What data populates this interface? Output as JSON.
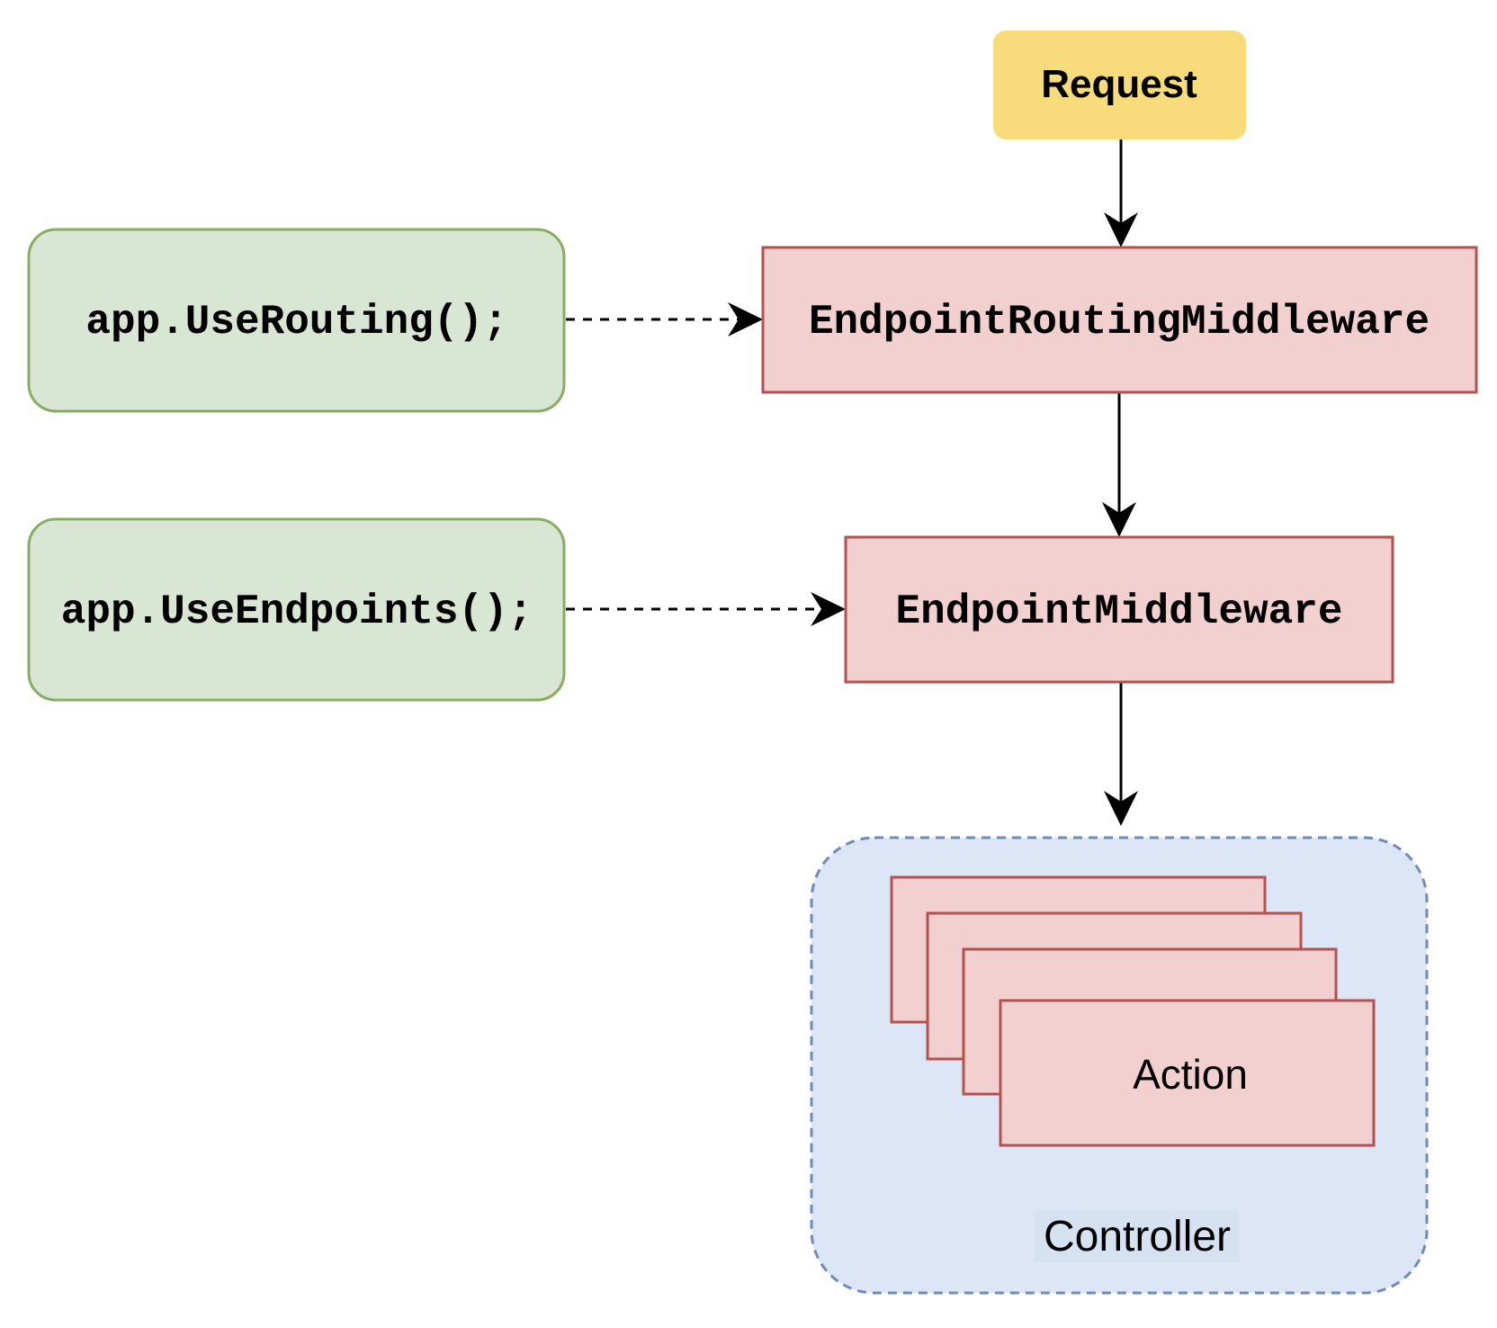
{
  "nodes": {
    "request": "Request",
    "routing_middleware": "EndpointRoutingMiddleware",
    "endpoint_middleware": "EndpointMiddleware",
    "use_routing": "app.UseRouting();",
    "use_endpoints": "app.UseEndpoints();",
    "action": "Action",
    "controller": "Controller"
  },
  "colors": {
    "request_fill": "#f8db7b",
    "middleware_fill": "#f2d0cf",
    "middleware_stroke": "#b5514e",
    "code_fill": "#dae6d4",
    "code_stroke": "#86ad62",
    "controller_fill": "#dce6f7",
    "controller_stroke": "#6f8bbd"
  }
}
